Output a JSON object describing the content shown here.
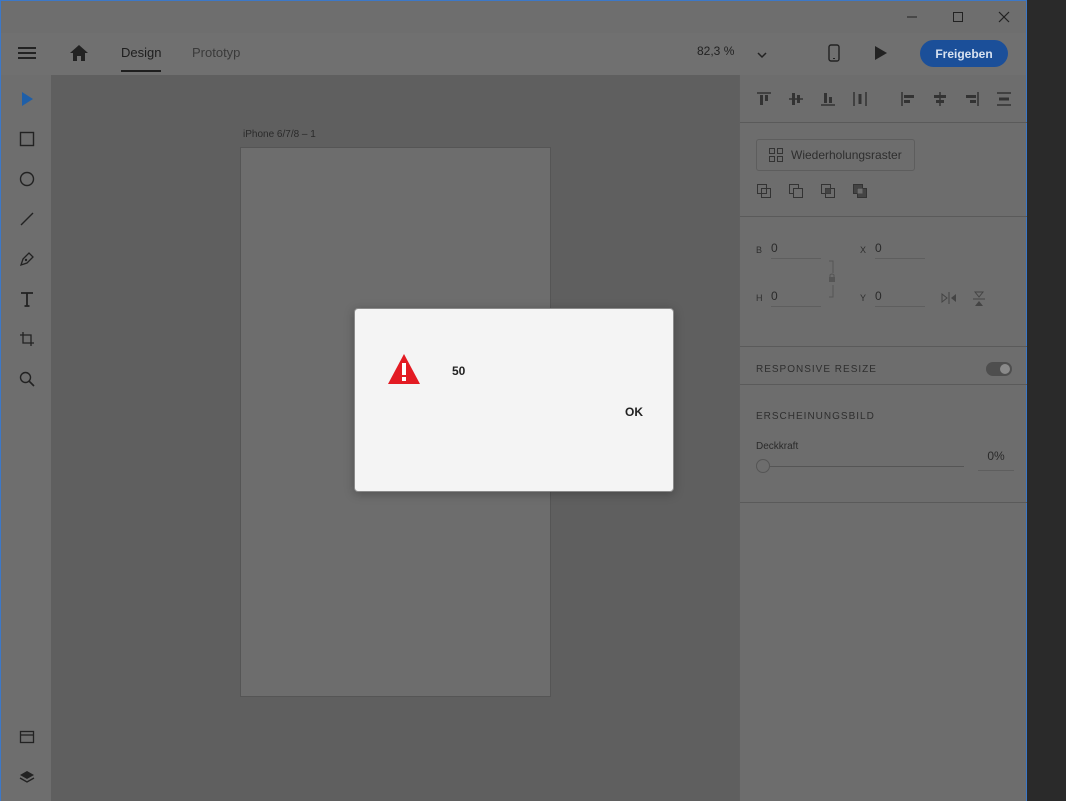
{
  "window": {
    "controls": {
      "minimize": "minimize-icon",
      "maximize": "maximize-icon",
      "close": "close-icon"
    }
  },
  "appbar": {
    "tabs": [
      {
        "label": "Design"
      },
      {
        "label": "Prototyp"
      }
    ],
    "zoom": "82,3 %",
    "share_label": "Freigeben",
    "accent": "#1b4f99"
  },
  "toolbar": {
    "tools": [
      "select-icon",
      "rectangle-icon",
      "ellipse-icon",
      "line-icon",
      "pen-icon",
      "text-icon",
      "artboard-icon",
      "zoom-icon"
    ],
    "bottom": [
      "assets-icon",
      "layers-icon"
    ]
  },
  "canvas": {
    "artboard_label": "iPhone 6/7/8 – 1"
  },
  "panel": {
    "repeat_grid_label": "Wiederholungsraster",
    "fields": {
      "b_label": "B",
      "b_value": "0",
      "h_label": "H",
      "h_value": "0",
      "x_label": "X",
      "x_value": "0",
      "y_label": "Y",
      "y_value": "0"
    },
    "responsive_resize": "RESPONSIVE RESIZE",
    "appearance": "ERSCHEINUNGSBILD",
    "opacity_label": "Deckkraft",
    "opacity_value": "0%"
  },
  "dialog": {
    "message": "50",
    "ok_label": "OK",
    "icon": "warning-icon",
    "icon_color": "#e31b23"
  }
}
